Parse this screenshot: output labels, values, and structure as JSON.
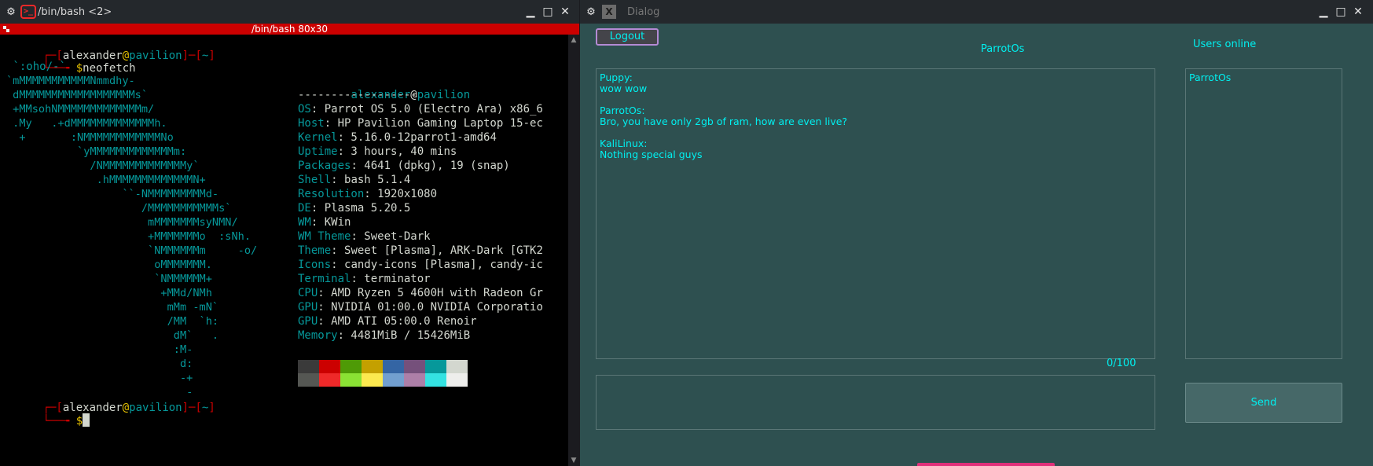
{
  "terminal": {
    "window_title": "/bin/bash <2>",
    "header_title": "/bin/bash 80x30",
    "prompt1": {
      "bracket_open": "┌─[",
      "user": "alexander",
      "at": "@",
      "host": "pavilion",
      "mid": "]─[",
      "dir": "~",
      "close": "]"
    },
    "cmd_line": {
      "prefix": "└──╼ ",
      "dollar": "$",
      "command": "neofetch"
    },
    "logo_first": " `:oho/-`",
    "logo": "`mMMMMMMMMMMMNmmdhy-\n dMMMMMMMMMMMMMMMMMMs`\n +MMsohNMMMMMMMMMMMMMm/\n .My   .+dMMMMMMMMMMMMMh.\n  +       :NMMMMMMMMMMMMNo\n           `yMMMMMMMMMMMMMm:\n             /NMMMMMMMMMMMMMy`\n              .hMMMMMMMMMMMMMN+\n                  ``-NMMMMMMMMMd-\n                     /MMMMMMMMMMMs`\n                      mMMMMMMMsyNMN/\n                      +MMMMMMMo  :sNh.\n                      `NMMMMMMm     -o/\n                       oMMMMMMM.\n                       `NMMMMMM+\n                        +MMd/NMh\n                         mMm -mN`\n                         /MM  `h:\n                          dM`   .\n                          :M-\n                           d:\n                           -+\n                            -",
    "info_header": {
      "user": "alexander",
      "at": "@",
      "host": "pavilion"
    },
    "info_sep": "------------------",
    "info": [
      {
        "key": "OS",
        "value": ": Parrot OS 5.0 (Electro Ara) x86_6"
      },
      {
        "key": "Host",
        "value": ": HP Pavilion Gaming Laptop 15-ec"
      },
      {
        "key": "Kernel",
        "value": ": 5.16.0-12parrot1-amd64"
      },
      {
        "key": "Uptime",
        "value": ": 3 hours, 40 mins"
      },
      {
        "key": "Packages",
        "value": ": 4641 (dpkg), 19 (snap)"
      },
      {
        "key": "Shell",
        "value": ": bash 5.1.4"
      },
      {
        "key": "Resolution",
        "value": ": 1920x1080"
      },
      {
        "key": "DE",
        "value": ": Plasma 5.20.5"
      },
      {
        "key": "WM",
        "value": ": KWin"
      },
      {
        "key": "WM Theme",
        "value": ": Sweet-Dark"
      },
      {
        "key": "Theme",
        "value": ": Sweet [Plasma], ARK-Dark [GTK2"
      },
      {
        "key": "Icons",
        "value": ": candy-icons [Plasma], candy-ic"
      },
      {
        "key": "Terminal",
        "value": ": terminator"
      },
      {
        "key": "CPU",
        "value": ": AMD Ryzen 5 4600H with Radeon Gr"
      },
      {
        "key": "GPU",
        "value": ": NVIDIA 01:00.0 NVIDIA Corporatio"
      },
      {
        "key": "GPU",
        "value": ": AMD ATI 05:00.0 Renoir"
      },
      {
        "key": "Memory",
        "value": ": 4481MiB / 15426MiB"
      }
    ],
    "palette_row1": [
      "#3a3a3a",
      "#cc0000",
      "#4e9a06",
      "#c4a000",
      "#3465a4",
      "#75507b",
      "#06989a",
      "#d3d7cf"
    ],
    "palette_row2": [
      "#555753",
      "#ef2929",
      "#8ae234",
      "#fce94f",
      "#729fcf",
      "#ad7fa8",
      "#34e2e2",
      "#eeeeec"
    ],
    "prompt2": {
      "bracket_open": "┌─[",
      "user": "alexander",
      "at": "@",
      "host": "pavilion",
      "mid": "]─[",
      "dir": "~",
      "close": "]"
    },
    "prompt2_line": {
      "prefix": "└──╼ ",
      "dollar": "$"
    }
  },
  "dialog": {
    "window_title": "Dialog",
    "logout_label": "Logout",
    "current_user": "ParrotOs",
    "users_online_label": "Users online",
    "messages": [
      {
        "sender": "Puppy:",
        "text": "wow wow"
      },
      {
        "sender": "ParrotOs:",
        "text": "Bro, you have only 2gb of ram, how are even live?"
      },
      {
        "sender": "KaliLinux:",
        "text": "Nothing special guys"
      }
    ],
    "users": [
      "ParrotOs"
    ],
    "char_counter": "0/100",
    "send_label": "Send"
  }
}
